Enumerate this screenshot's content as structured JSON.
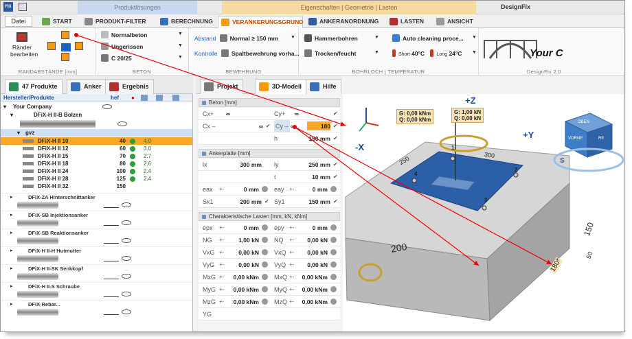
{
  "titlebar": {
    "ctx_left": "Produktlösungen",
    "ctx_right": "Eigenschaften | Geometrie | Lasten",
    "app_title": "DesignFix"
  },
  "tabs": {
    "file": "Datei",
    "items": [
      "START",
      "PRODUKT-FILTER",
      "BERECHNUNG",
      "VERANKERUNGSGRUND",
      "ANKERANORDNUNG",
      "LASTEN",
      "ANSICHT"
    ]
  },
  "ribbon": {
    "raender_label": "Ränder bearbeiten",
    "grp_randabstaende": "RANDABSTÄNDE [mm]",
    "grp_beton": "BETON",
    "beton_items": [
      "Normalbeton",
      "Ungerissen",
      "C 20/25"
    ],
    "abstand_label": "Abstand",
    "abstand_value": "Normal ≥ 150 mm",
    "kontrolle_label": "Kontrolle",
    "kontrolle_value": "Spaltbewehrung vorha...",
    "grp_bewehrung": "BEWEHRUNG",
    "bohr_items": [
      "Hammerbohren",
      "Trocken/feucht"
    ],
    "auto_cleaning": "Auto cleaning proce...",
    "short_label": "Short",
    "short_temp": "40°C",
    "long_label": "Long",
    "long_temp": "24°C",
    "grp_bohrloch": "BOHRLOCH | TEMPERATUR",
    "designfix_label": "DesignFix 2.0",
    "logo_text": "Your C"
  },
  "left_tabs": [
    "47 Produkte",
    "Anker",
    "Ergebnis"
  ],
  "mid_tabs": [
    "Projekt",
    "3D-Modell",
    "Hilfe"
  ],
  "tree": {
    "header_name": "Hersteller/Produkte",
    "header_hef": "hef",
    "company": "Your Company",
    "family": "DFiX-H II-B Bolzen",
    "subfamily": "gvz",
    "rows": [
      {
        "name": "DFiX-H II 10",
        "hef": "40",
        "v2": "4.0",
        "selected": true
      },
      {
        "name": "DFiX-H II 12",
        "hef": "60",
        "v2": "3.0"
      },
      {
        "name": "DFiX-H II 15",
        "hef": "70",
        "v2": "2.7"
      },
      {
        "name": "DFiX-H II 18",
        "hef": "80",
        "v2": "2.6"
      },
      {
        "name": "DFiX-H II 24",
        "hef": "100",
        "v2": "2.4"
      },
      {
        "name": "DFiX-H II 28",
        "hef": "125",
        "v2": "2.4"
      },
      {
        "name": "DFiX-H II 32",
        "hef": "150",
        "v2": ""
      }
    ],
    "groups": [
      "DFiX-ZA Hinterschnittanker",
      "DFiX-SB Injektionsanker",
      "DFiX-SB Reaktionsanker",
      "DFiX-H II-H Hutmutter",
      "DFiX-H II-SK Senkkopf",
      "DFiX-H II-S Schraube",
      "DFiX-Rebar..."
    ]
  },
  "props": {
    "beton_title": "Beton [mm]",
    "cxp": "Cx+",
    "cxp_val": "∞",
    "cyp": "Cy+",
    "cyp_val": "∞",
    "cxm": "Cx –",
    "cxm_val": "∞",
    "cym": "Cy –",
    "cym_val": "∞",
    "cym_edit": "180",
    "h": "h",
    "h_val": "150 mm",
    "anker_title": "Ankerplatte [mm]",
    "lx": "lx",
    "lx_val": "300 mm",
    "ly": "ly",
    "ly_val": "250 mm",
    "t": "t",
    "t_val": "10 mm",
    "eax": "eax",
    "eax_val": "0 mm",
    "eay": "eay",
    "eay_val": "0 mm",
    "sx1": "Sx1",
    "sx1_val": "200 mm",
    "sy1": "Sy1",
    "sy1_val": "150 mm",
    "lasten_title": "Charakteristische Lasten [mm, kN, kNm]",
    "epx": "epx",
    "epx_val": "0 mm",
    "epy": "epy",
    "epy_val": "0 mm",
    "ng": "NG",
    "ng_val": "1,00 kN",
    "nq": "NQ",
    "nq_val": "0,00 kN",
    "vxg": "VxG",
    "vxg_val": "0,00 kN",
    "vxq": "VxQ",
    "vxq_val": "0,00 kN",
    "vyg": "VyG",
    "vyg_val": "0,00 kN",
    "vyq": "VyQ",
    "vyq_val": "0,00 kN",
    "mxg": "MxG",
    "mxg_val": "0,00 kNm",
    "mxq": "MxQ",
    "mxq_val": "0,00 kNm",
    "myg": "MyG",
    "myg_val": "0,00 kNm",
    "myq": "MyQ",
    "myq_val": "0,00 kNm",
    "mzg": "MzG",
    "mzg_val": "0,00 kNm",
    "mzq": "MzQ",
    "mzq_val": "0,00 kNm",
    "yg": "YG",
    "pm": "+-"
  },
  "view": {
    "annot_left": [
      "G: 0,00 kNm",
      "Q: 0,00 kNm"
    ],
    "annot_right": [
      "G: 1,00 kN",
      "Q: 0,00 kN"
    ],
    "axis_z": "+Z",
    "axis_y": "+Y",
    "axis_x": "-X",
    "cube_top": "OBEN",
    "cube_front": "VORNE",
    "cube_right": "RE",
    "dim_250": "250",
    "dim_300": "300",
    "dim_200": "200",
    "dim_150": "150",
    "dim_50": "50",
    "dim_180": "180*",
    "anchors": [
      "1",
      "2",
      "3",
      "4"
    ],
    "compass": "S"
  }
}
